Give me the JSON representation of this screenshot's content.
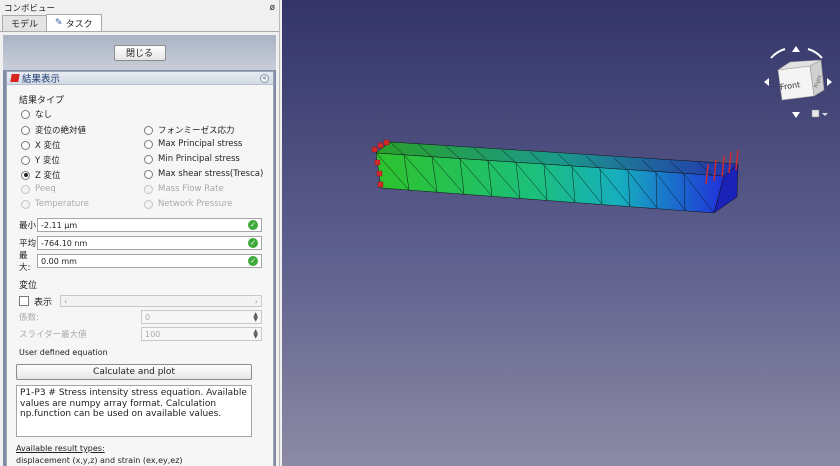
{
  "panel": {
    "title": "コンボビュー",
    "pin_glyph": "ø",
    "tabs": [
      {
        "label": "モデル"
      },
      {
        "label": "タスク"
      }
    ],
    "close_label": "閉じる"
  },
  "result_box": {
    "title": "結果表示",
    "result_type_label": "結果タイプ",
    "options_left": [
      "なし",
      "変位の絶対値",
      "X 変位",
      "Y 変位",
      "Z 変位",
      "Peeq",
      "Temperature"
    ],
    "options_right": [
      "フォンミーゼス応力",
      "Max Principal stress",
      "Min Principal stress",
      "Max shear stress(Tresca)",
      "Mass Flow Rate",
      "Network Pressure"
    ],
    "selected": "Z 変位",
    "min_label": "最小",
    "min_value": "-2.11 μm",
    "avg_label": "平均",
    "avg_value": "-764.10 nm",
    "max_label": "最大:",
    "max_value": "0.00 mm",
    "displacement_label": "変位",
    "show_label": "表示",
    "factor_label": "係数:",
    "factor_value": "0",
    "slider_max_label": "スライダー最大値",
    "slider_max_value": "100",
    "user_eq_label": "User defined equation",
    "calc_label": "Calculate and plot",
    "equation_text": "P1-P3 # Stress intensity stress equation. Available values are numpy array format. Calculation np.function can be used on available values.",
    "available_label": "Available result types:",
    "result_types_text": "displacement (x,y,z) and strain (ex,ey,ez)"
  },
  "navcube": {
    "face_label": "Front",
    "side_label": "Right"
  },
  "colors": {
    "beam_left": "#2fbf2f",
    "beam_mid": "#1fb5b0",
    "beam_right": "#1f2fd8",
    "constraint": "#d42a2a"
  }
}
